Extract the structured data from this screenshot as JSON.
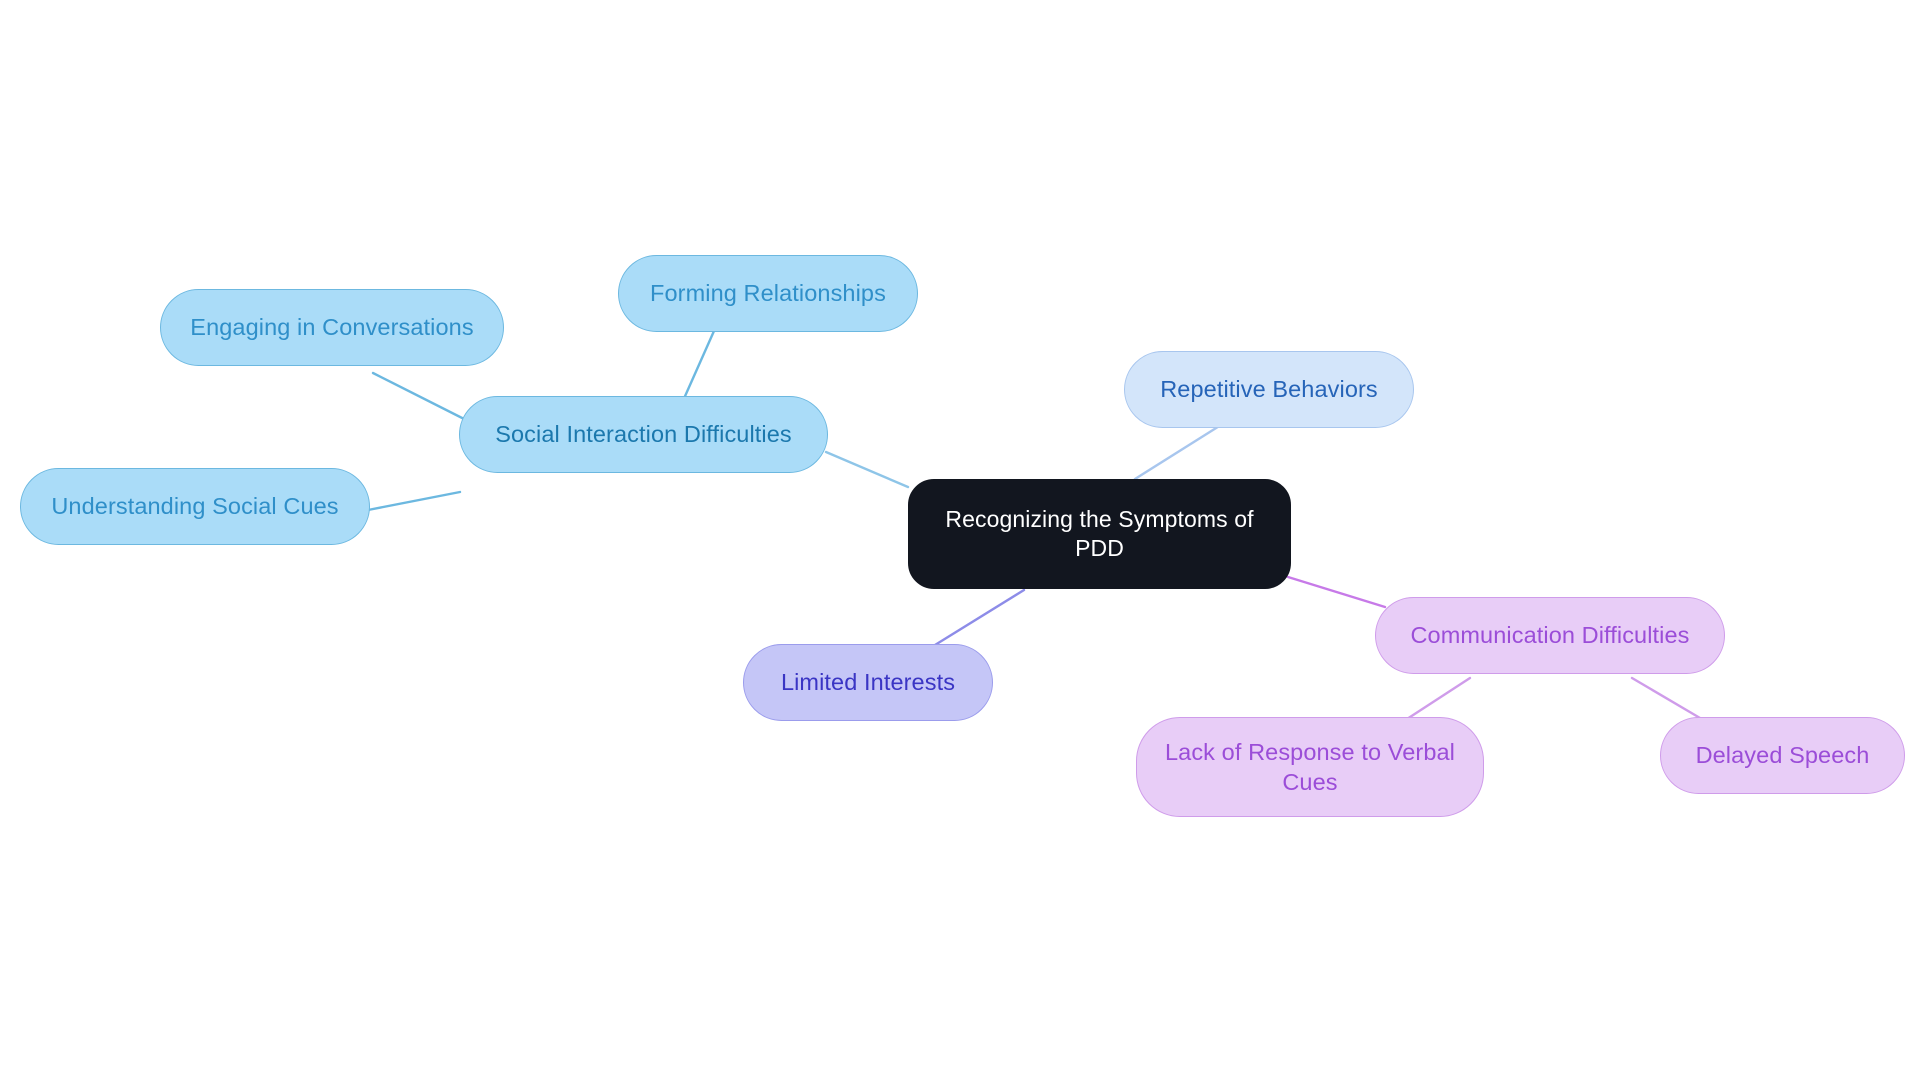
{
  "diagram": {
    "type": "mindmap",
    "background": "#ffffff",
    "root": {
      "id": "root",
      "label": "Recognizing the Symptoms of PDD",
      "fill": "#12161f",
      "text": "#ffffff",
      "border": "#12161f"
    },
    "branches": [
      {
        "id": "social-interaction-difficulties",
        "label": "Social Interaction Difficulties",
        "fill": "#aadcf8",
        "text": "#1b78ad",
        "border": "#6cb8e0",
        "edge_color": "#8ec5e8",
        "children": [
          {
            "id": "engaging-in-conversations",
            "label": "Engaging in Conversations",
            "fill": "#aadcf8",
            "text": "#2f8fc9",
            "border": "#6cb8e0"
          },
          {
            "id": "forming-relationships",
            "label": "Forming Relationships",
            "fill": "#aadcf8",
            "text": "#2f8fc9",
            "border": "#6cb8e0"
          },
          {
            "id": "understanding-social-cues",
            "label": "Understanding Social Cues",
            "fill": "#aadcf8",
            "text": "#2f8fc9",
            "border": "#6cb8e0"
          }
        ]
      },
      {
        "id": "repetitive-behaviors",
        "label": "Repetitive Behaviors",
        "fill": "#d3e5fa",
        "text": "#2664b8",
        "border": "#a8c6ee",
        "edge_color": "#a8c6ee",
        "children": []
      },
      {
        "id": "limited-interests",
        "label": "Limited Interests",
        "fill": "#c5c6f7",
        "text": "#3a35c4",
        "border": "#9b9cec",
        "edge_color": "#8d8ce8",
        "children": []
      },
      {
        "id": "communication-difficulties",
        "label": "Communication Difficulties",
        "fill": "#e8cdf7",
        "text": "#9b4dd8",
        "border": "#cf9cea",
        "edge_color": "#c77ae8",
        "children": [
          {
            "id": "lack-of-response-to-verbal-cues",
            "label": "Lack of Response to Verbal Cues",
            "fill": "#e8cdf7",
            "text": "#9b4dd8",
            "border": "#cf9cea"
          },
          {
            "id": "delayed-speech",
            "label": "Delayed Speech",
            "fill": "#e8cdf7",
            "text": "#9b4dd8",
            "border": "#cf9cea"
          }
        ]
      }
    ]
  }
}
